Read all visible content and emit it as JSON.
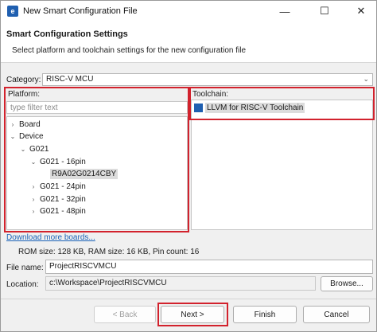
{
  "window": {
    "title": "New Smart Configuration File",
    "app_icon_glyph": "e",
    "controls": {
      "minimize": "—",
      "maximize": "☐",
      "close": "✕"
    }
  },
  "header": {
    "title": "Smart Configuration Settings",
    "description": "Select platform and toolchain settings for the new configuration file"
  },
  "category": {
    "label": "Category:",
    "value": "RISC-V MCU"
  },
  "platform": {
    "label": "Platform:",
    "filter_placeholder": "type filter text",
    "tree": [
      {
        "label": "Board",
        "toggle": "›"
      },
      {
        "label": "Device",
        "toggle": "⌄"
      },
      {
        "label": "G021",
        "toggle": "⌄"
      },
      {
        "label": "G021 - 16pin",
        "toggle": "⌄"
      },
      {
        "label": "R9A02G0214CBY",
        "toggle": ""
      },
      {
        "label": "G021 - 24pin",
        "toggle": "›"
      },
      {
        "label": "G021 - 32pin",
        "toggle": "›"
      },
      {
        "label": "G021 - 48pin",
        "toggle": "›"
      }
    ]
  },
  "toolchain": {
    "label": "Toolchain:",
    "items": [
      "LLVM for RISC-V Toolchain"
    ]
  },
  "download_link": "Download more boards...",
  "device_info": "ROM size: 128 KB, RAM size: 16 KB, Pin count: 16",
  "file_name": {
    "label": "File name:",
    "value": "ProjectRISCVMCU"
  },
  "location": {
    "label": "Location:",
    "value": "c:\\Workspace\\ProjectRISCVMCU",
    "browse": "Browse..."
  },
  "buttons": {
    "back": "< Back",
    "next": "Next >",
    "finish": "Finish",
    "cancel": "Cancel"
  },
  "colors": {
    "highlight": "#d2222d",
    "link": "#1c63b8",
    "accent": "#1f5fb0"
  }
}
